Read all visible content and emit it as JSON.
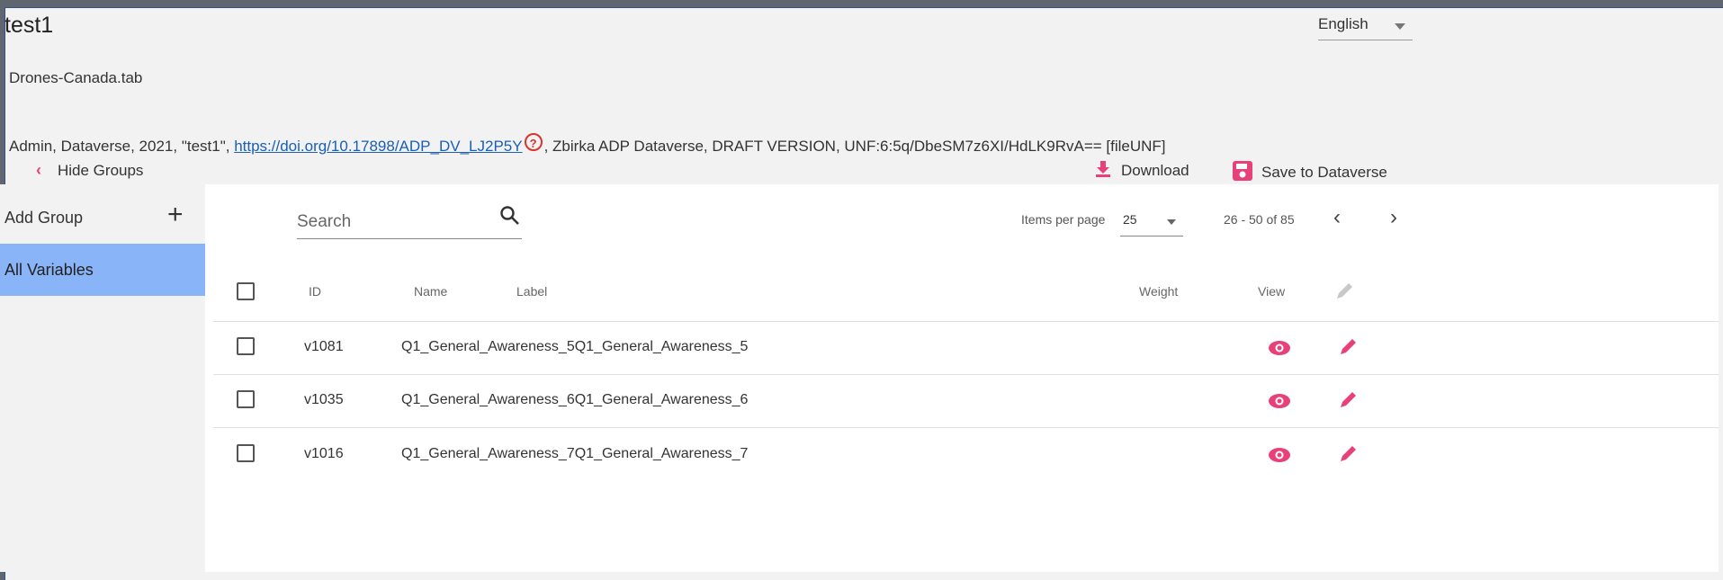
{
  "header": {
    "title": "test1",
    "language": "English",
    "filename": "Drones-Canada.tab"
  },
  "citation": {
    "prefix": "Admin, Dataverse, 2021, \"test1\", ",
    "doi_link": "https://doi.org/10.17898/ADP_DV_LJ2P5Y",
    "suffix": ", Zbirka ADP Dataverse, DRAFT VERSION, UNF:6:5q/DbeSM7z6XI/HdLK9RvA== [fileUNF]",
    "help_icon": "?"
  },
  "toolbar": {
    "hide_groups": "Hide Groups",
    "download": "Download",
    "save": "Save to Dataverse"
  },
  "sidebar": {
    "add_group": "Add Group",
    "add_icon": "+",
    "all_variables": "All Variables"
  },
  "search": {
    "placeholder": "Search"
  },
  "pagination": {
    "items_per_page_label": "Items per page",
    "items_per_page_value": "25",
    "range": "26 - 50 of 85"
  },
  "table": {
    "headers": {
      "id": "ID",
      "name": "Name",
      "label": "Label",
      "weight": "Weight",
      "view": "View"
    },
    "rows": [
      {
        "id": "v1081",
        "name": "Q1_General_Awareness_5Q1_General_Awareness_5"
      },
      {
        "id": "v1035",
        "name": "Q1_General_Awareness_6Q1_General_Awareness_6"
      },
      {
        "id": "v1016",
        "name": "Q1_General_Awareness_7Q1_General_Awareness_7"
      }
    ]
  },
  "colors": {
    "accent": "#e8417a",
    "selected": "#8ab4f8",
    "link": "#1a5fb4"
  }
}
